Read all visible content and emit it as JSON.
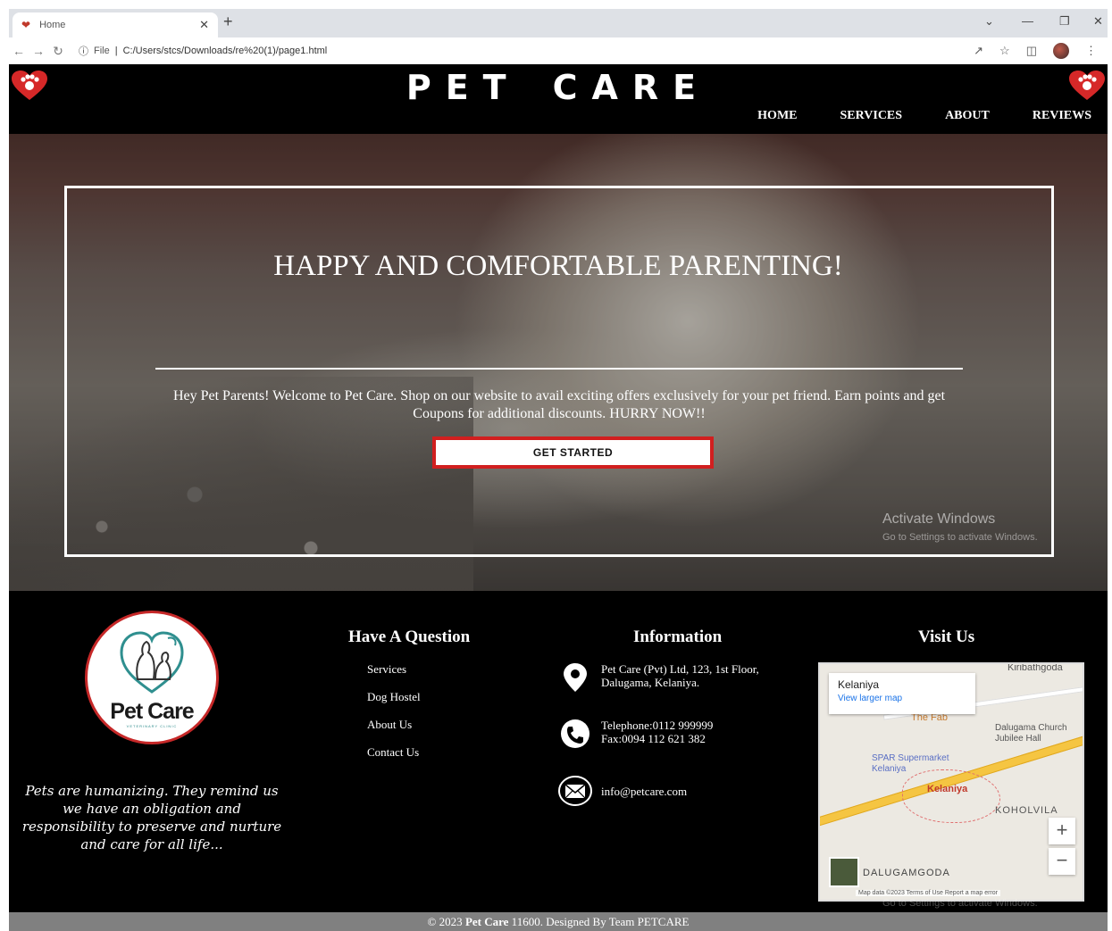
{
  "browser": {
    "tab_title": "Home",
    "url_scheme": "File",
    "url": "C:/Users/stcs/Downloads/re%20(1)/page1.html"
  },
  "site": {
    "brand_word1": "PET",
    "brand_word2": "CARE",
    "nav": [
      "HOME",
      "SERVICES",
      "ABOUT",
      "REVIEWS"
    ]
  },
  "hero": {
    "heading": "HAPPY AND COMFORTABLE PARENTING!",
    "text": "Hey Pet Parents! Welcome to Pet Care. Shop on our website to avail exciting offers exclusively for your pet friend. Earn points and get Coupons for additional discounts. HURRY NOW!!",
    "cta_label": "GET STARTED"
  },
  "watermark": {
    "line1": "Activate Windows",
    "line2": "Go to Settings to activate Windows."
  },
  "footer": {
    "logo_text": "Pet Care",
    "logo_sub": "VETERINARY CLINIC",
    "quote": "Pets are humanizing. They remind us we have an obligation and responsibility to preserve and nurture and care for all life...",
    "question_heading": "Have A Question",
    "question_links": [
      "Services",
      "Dog Hostel",
      "About Us",
      "Contact Us"
    ],
    "info_heading": "Information",
    "address": "Pet Care (Pvt) Ltd, 123, 1st Floor, Dalugama, Kelaniya.",
    "telephone": "Telephone:0112 999999",
    "fax": "Fax:0094 112 621 382",
    "email": "info@petcare.com",
    "visit_heading": "Visit Us",
    "map": {
      "place": "Kelaniya",
      "view_larger": "View larger map",
      "labels": [
        "Kiribathgoda",
        "The Fab",
        "Dalugama Church",
        "Jubilee Hall",
        "SPAR Supermarket",
        "Kelaniya",
        "Kelaniya",
        "KOHOLVILA",
        "DALUGAMGODA"
      ],
      "attribution": "Map data ©2023  Terms of Use  Report a map error"
    },
    "copyright_prefix": "© 2023",
    "copyright_brand": "Pet Care",
    "copyright_suffix": "11600. Designed By Team PETCARE"
  }
}
